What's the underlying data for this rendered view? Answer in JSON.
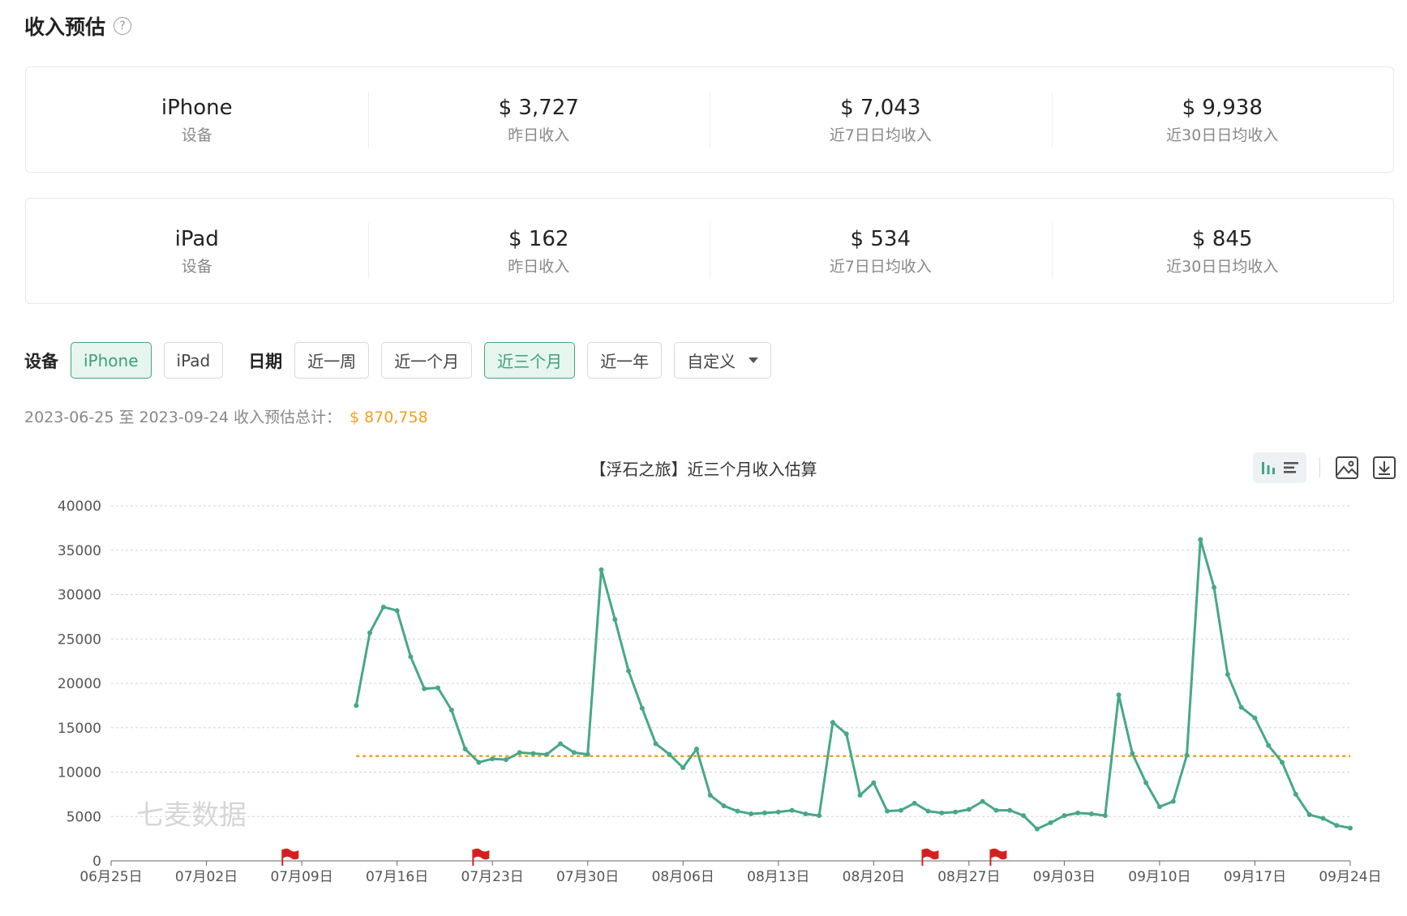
{
  "page": {
    "title": "收入预估",
    "help_icon": "question-circle-icon"
  },
  "cards": {
    "iphone": {
      "device": "iPhone",
      "device_label": "设备",
      "yesterday": "$ 3,727",
      "yesterday_label": "昨日收入",
      "avg7": "$ 7,043",
      "avg7_label": "近7日日均收入",
      "avg30": "$ 9,938",
      "avg30_label": "近30日日均收入"
    },
    "ipad": {
      "device": "iPad",
      "device_label": "设备",
      "yesterday": "$ 162",
      "yesterday_label": "昨日收入",
      "avg7": "$ 534",
      "avg7_label": "近7日日均收入",
      "avg30": "$ 845",
      "avg30_label": "近30日日均收入"
    }
  },
  "filters": {
    "device_label": "设备",
    "devices": [
      {
        "label": "iPhone",
        "active": true
      },
      {
        "label": "iPad",
        "active": false
      }
    ],
    "date_label": "日期",
    "ranges": [
      {
        "label": "近一周",
        "active": false
      },
      {
        "label": "近一个月",
        "active": false
      },
      {
        "label": "近三个月",
        "active": true
      },
      {
        "label": "近一年",
        "active": false
      }
    ],
    "custom": {
      "label": "自定义",
      "icon": "caret-down-icon"
    }
  },
  "summary": {
    "text": "2023-06-25 至 2023-09-24 收入预估总计：",
    "total": "$ 870,758"
  },
  "toolbox": {
    "icons": [
      "bar-chart-icon",
      "list-icon",
      "image-icon",
      "download-icon"
    ]
  },
  "colors": {
    "accent": "#43a585",
    "line": "#48a886",
    "average": "#f0a020",
    "flag": "#d62020",
    "total": "#f0a020"
  },
  "chart_data": {
    "type": "line",
    "title": "【浮石之旅】近三个月收入估算",
    "watermark": "七麦数据",
    "x_ticks": [
      "06月25日",
      "07月02日",
      "07月09日",
      "07月16日",
      "07月23日",
      "07月30日",
      "08月06日",
      "08月13日",
      "08月20日",
      "08月27日",
      "09月03日",
      "09月10日",
      "09月17日",
      "09月24日"
    ],
    "ylim": [
      0,
      40000
    ],
    "y_ticks": [
      0,
      5000,
      10000,
      15000,
      20000,
      25000,
      30000,
      35000,
      40000
    ],
    "grid": true,
    "x_start": "06月25日",
    "series": [
      {
        "start_index": 18,
        "values": [
          17500,
          25700,
          28600,
          28200,
          23000,
          19400,
          19500,
          17000,
          12600,
          11100,
          11500,
          11400,
          12200,
          12100,
          12000,
          13200,
          12200,
          12000,
          32800,
          27200,
          21400,
          17200,
          13200,
          12000,
          10500,
          12600,
          7400,
          6200,
          5600,
          5300,
          5400,
          5500,
          5700,
          5300,
          5100,
          15600,
          14300,
          7400,
          8800,
          5600,
          5700,
          6500,
          5600,
          5400,
          5500,
          5800,
          6700,
          5700,
          5700,
          5100,
          3600,
          4300,
          5100,
          5400,
          5300,
          5100,
          18700,
          12100,
          8800,
          6100,
          6700,
          11900,
          36200,
          30800,
          21000,
          17300,
          16100,
          13000,
          11100,
          7500,
          5200,
          4800,
          4000,
          3700
        ]
      }
    ],
    "average_line": {
      "value": 11800,
      "start_index": 18,
      "end_index": 91
    },
    "event_flags": [
      13,
      27,
      60,
      65
    ]
  }
}
